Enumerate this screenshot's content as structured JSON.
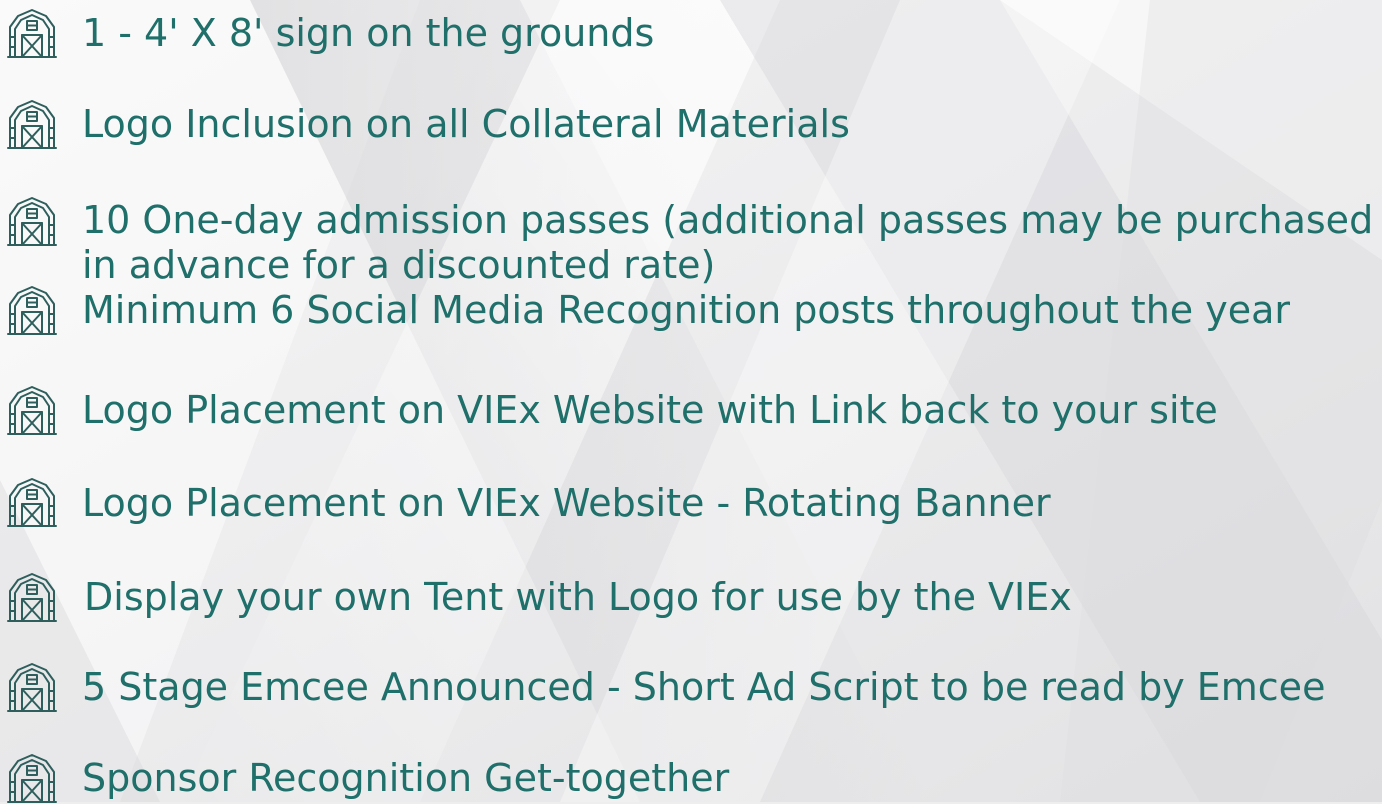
{
  "benefits": [
    {
      "text": "1 - 4' X 8' sign on the grounds",
      "icon": "barn-icon"
    },
    {
      "text": "Logo Inclusion on all Collateral Materials",
      "icon": "barn-icon"
    },
    {
      "text": "10 One-day admission passes (additional passes may be purchased in advance for a discounted rate)",
      "icon": "barn-icon"
    },
    {
      "text": "Minimum 6 Social Media Recognition posts throughout the year",
      "icon": "barn-icon"
    },
    {
      "text": "Logo Placement on VIEx Website with Link back to your site",
      "icon": "barn-icon"
    },
    {
      "text": "Logo Placement on VIEx Website - Rotating Banner",
      "icon": "barn-icon"
    },
    {
      "text": "Display your own Tent with Logo for use by the VIEx",
      "icon": "barn-icon"
    },
    {
      "text": "5 Stage Emcee Announced - Short Ad Script to be read by Emcee",
      "icon": "barn-icon"
    },
    {
      "text": "Sponsor Recognition Get-together",
      "icon": "barn-icon"
    }
  ],
  "colors": {
    "text": "#1f6f6a",
    "icon": "#2e5f5c",
    "background": "#eeeeef"
  }
}
